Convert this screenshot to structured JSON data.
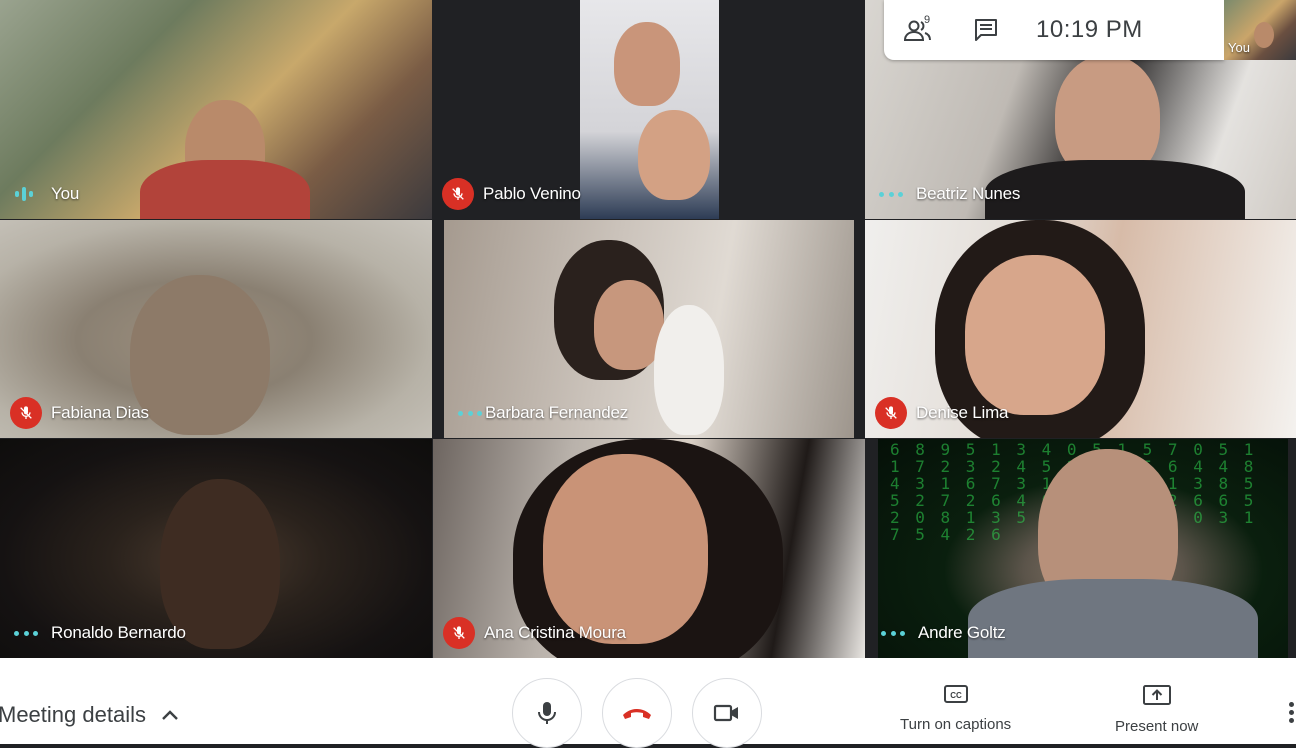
{
  "meeting": {
    "participant_count": "9",
    "time": "10:19  PM"
  },
  "self_view": {
    "label": "You"
  },
  "participants": [
    {
      "name": "You",
      "status": "speaking"
    },
    {
      "name": "Pablo Venino",
      "status": "muted"
    },
    {
      "name": "Beatriz Nunes",
      "status": "unmuted"
    },
    {
      "name": "Fabiana Dias",
      "status": "muted"
    },
    {
      "name": "Barbara Fernandez",
      "status": "unmuted"
    },
    {
      "name": "Denise Lima",
      "status": "muted"
    },
    {
      "name": "Ronaldo Bernardo",
      "status": "unmuted"
    },
    {
      "name": "Ana Cristina Moura",
      "status": "muted"
    },
    {
      "name": "Andre Goltz",
      "status": "unmuted"
    }
  ],
  "bottom_bar": {
    "meeting_details": "Meeting details",
    "captions_label": "Turn on captions",
    "present_label": "Present now"
  },
  "matrix_text": "6 8 9 5 1 3 4 0 5 1 5 7 0 5 1 1 7 2 3 2 4 5 2 3 0 5 6 4 4 8 4 3 1 6 7 3 1 2 4 0 6 1 3 8 5 5 2 7 2 6 4 0 1 3 6 7 2 6 6 5 2 0 8 1 3 5 7 9 4 2 6 8 0 3 1 7 5 4 2 6",
  "colors": {
    "accent": "#5bd1d7",
    "mute_red": "#d93025",
    "hangup_red": "#d93025",
    "background": "#202124"
  }
}
